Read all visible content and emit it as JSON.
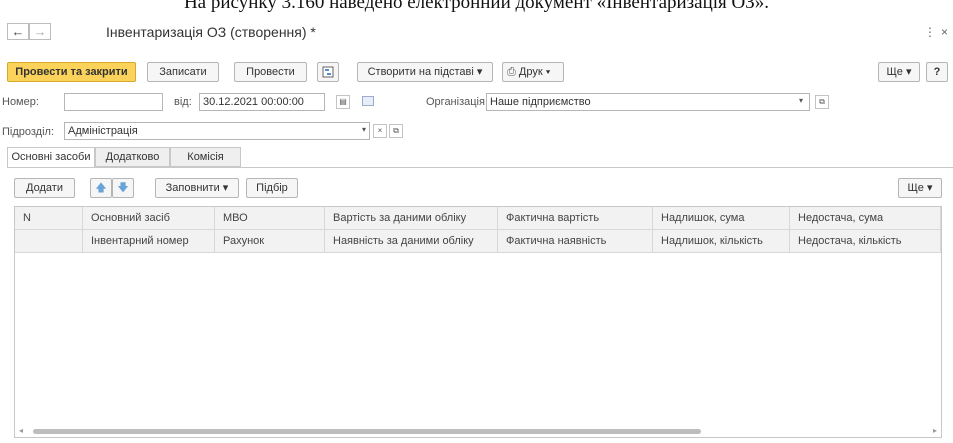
{
  "caption": "На рисунку 3.160 наведено електронний документ «Інвентаризація ОЗ».",
  "window": {
    "title": "Інвентаризація ОЗ (створення) *",
    "back": "←",
    "forward": "→",
    "menu_glyph": "⋮",
    "close_glyph": "×"
  },
  "toolbar": {
    "post_close": "Провести та закрити",
    "save": "Записати",
    "post": "Провести",
    "create_based": "Створити на підставі ▾",
    "print": "Друк ▾",
    "more": "Ще ▾",
    "help": "?"
  },
  "form": {
    "number_label": "Номер:",
    "number_value": "",
    "date_label": "від:",
    "date_value": "30.12.2021 00:00:00",
    "org_label": "Організація:",
    "org_value": "Наше підприємство",
    "dept_label": "Підрозділ:",
    "dept_value": "Адміністрація"
  },
  "tabs": [
    "Основні засоби",
    "Додатково",
    "Комісія"
  ],
  "table_toolbar": {
    "add": "Додати",
    "fill": "Заповнити ▾",
    "select": "Підбір",
    "more": "Ще ▾"
  },
  "columns_row1": [
    "N",
    "Основний засіб",
    "МВО",
    "Вартість за даними обліку",
    "Фактична вартість",
    "Надлишок, сума",
    "Недостача, сума"
  ],
  "columns_row2": [
    "",
    "Інвентарний номер",
    "Рахунок",
    "Наявність за даними обліку",
    "Фактична наявність",
    "Надлишок, кількість",
    "Недостача, кількість"
  ],
  "colors": {
    "primary_button": "#fbd35b",
    "accent_arrows": "#6aa3d8"
  },
  "icons": [
    "back-arrow-icon",
    "forward-arrow-icon",
    "more-vertical-icon",
    "close-icon",
    "calendar-icon",
    "info-card-icon",
    "printer-icon",
    "structure-icon",
    "arrow-up-icon",
    "arrow-down-icon",
    "dropdown-icon",
    "clear-icon",
    "open-icon"
  ]
}
